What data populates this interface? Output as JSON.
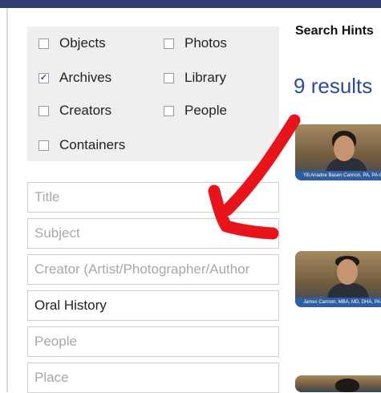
{
  "filters": {
    "objects": {
      "label": "Objects",
      "checked": false
    },
    "photos": {
      "label": "Photos",
      "checked": false
    },
    "archives": {
      "label": "Archives",
      "checked": true
    },
    "library": {
      "label": "Library",
      "checked": false
    },
    "creators": {
      "label": "Creators",
      "checked": false
    },
    "people": {
      "label": "People",
      "checked": false
    },
    "containers": {
      "label": "Containers",
      "checked": false
    }
  },
  "fields": {
    "title": {
      "placeholder": "Title",
      "value": ""
    },
    "subject": {
      "placeholder": "Subject",
      "value": ""
    },
    "creator": {
      "placeholder": "Creator (Artist/Photographer/Author",
      "value": ""
    },
    "collection": {
      "placeholder": "",
      "value": "Oral History"
    },
    "people": {
      "placeholder": "People",
      "value": ""
    },
    "place": {
      "placeholder": "Place",
      "value": ""
    }
  },
  "search_hints": "Search Hints",
  "results": {
    "count": "9",
    "label": "results"
  },
  "thumbnails": [
    {
      "caption": "Yill Ariadne Basen Cannon, PA, PA-C"
    },
    {
      "caption": "James Cannon, MBA, MD, DHA, PA-C"
    }
  ],
  "annotation_color": "#e8141b"
}
